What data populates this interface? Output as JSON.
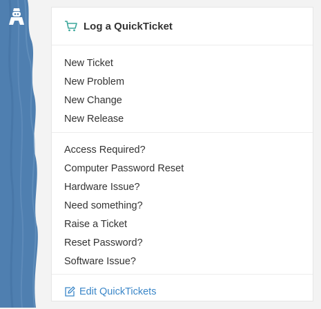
{
  "sidebar": {
    "color": "#4f7fb0",
    "logo_icon": "robot-logo-icon"
  },
  "panel": {
    "title": "Log a QuickTicket",
    "title_icon": "cart-icon",
    "accent": "#3aa69a"
  },
  "groups": [
    {
      "items": [
        "New Ticket",
        "New Problem",
        "New Change",
        "New Release"
      ]
    },
    {
      "items": [
        "Access Required?",
        "Computer Password Reset",
        "Hardware Issue?",
        "Need something?",
        "Raise a Ticket",
        "Reset Password?",
        "Software Issue?"
      ]
    }
  ],
  "footer": {
    "label": "Edit QuickTickets",
    "icon": "edit-icon",
    "color": "#3a86c8"
  }
}
